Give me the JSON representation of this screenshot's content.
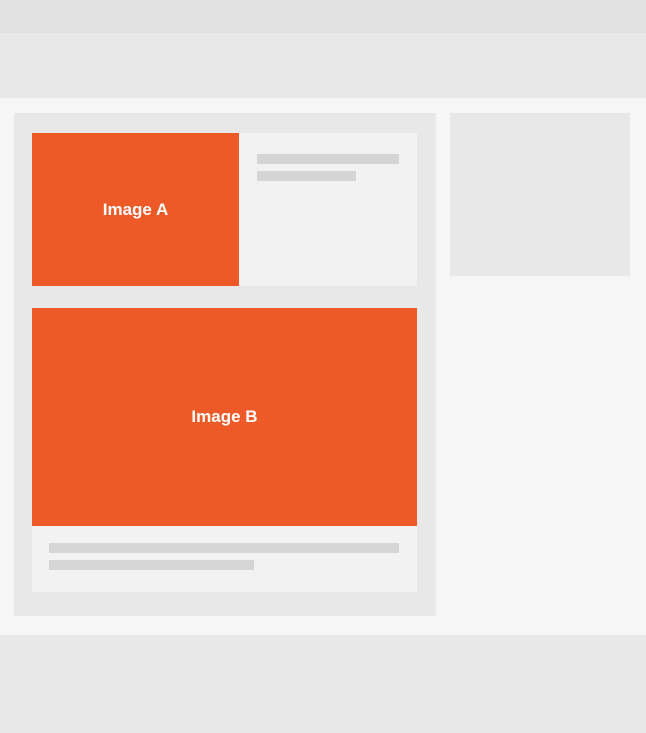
{
  "cards": {
    "a": {
      "image_label": "Image A"
    },
    "b": {
      "image_label": "Image B"
    }
  },
  "colors": {
    "accent": "#ee5a27",
    "panel": "#e8e8e8",
    "page": "#f6f6f6",
    "card": "#f2f2f2",
    "placeholder_line": "#d5d5d5"
  }
}
